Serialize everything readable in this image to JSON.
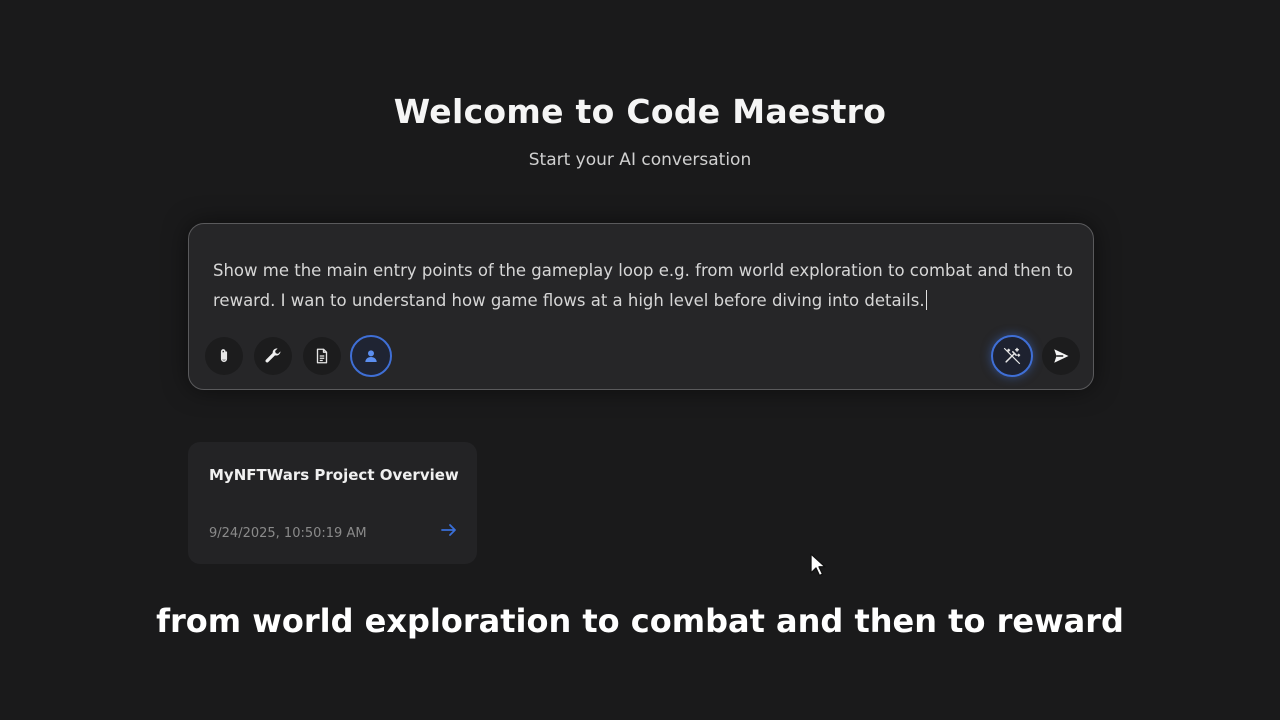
{
  "header": {
    "title": "Welcome to Code Maestro",
    "subtitle": "Start your AI conversation"
  },
  "composer": {
    "value": "Show me the main entry points of the gameplay loop e.g. from world exploration to combat and then to reward. I wan to understand how game flows at a high level before diving into details.",
    "tools": [
      {
        "name": "attach",
        "icon": "paperclip-icon"
      },
      {
        "name": "tools",
        "icon": "wrench-icon"
      },
      {
        "name": "document",
        "icon": "document-icon"
      },
      {
        "name": "persona",
        "icon": "user-icon",
        "active": true
      }
    ],
    "actions": [
      {
        "name": "enhance",
        "icon": "magic-wand-icon",
        "active": true
      },
      {
        "name": "send",
        "icon": "send-icon"
      }
    ],
    "accent_color": "#3f6fd6"
  },
  "recent": [
    {
      "title": "MyNFTWars Project Overview",
      "timestamp": "9/24/2025, 10:50:19 AM",
      "icon": "arrow-right-icon"
    }
  ],
  "subtitle_caption": "from world exploration to combat and then to reward"
}
